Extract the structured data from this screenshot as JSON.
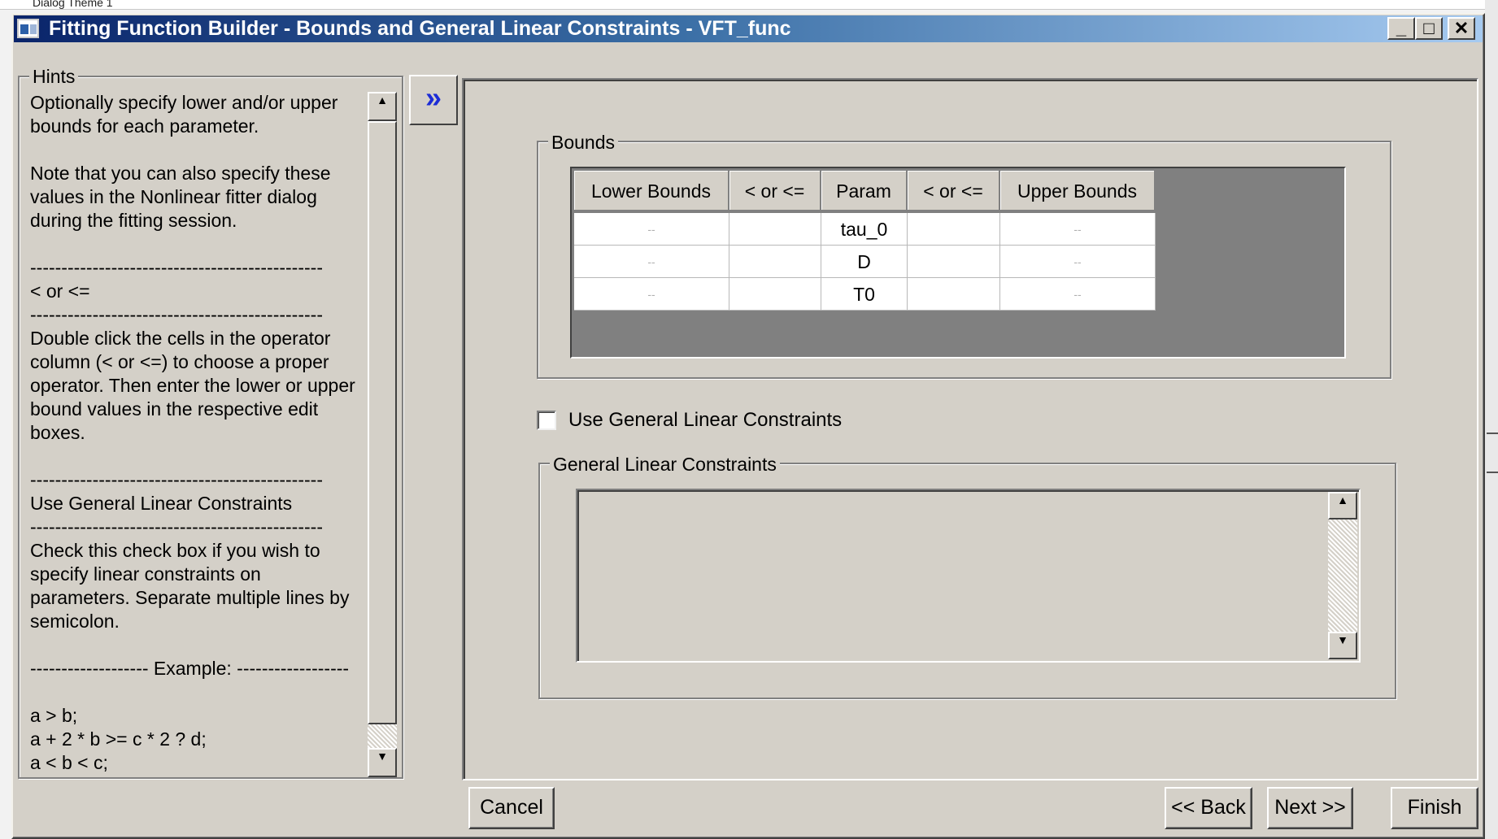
{
  "background": {
    "top_text": "Dialog Theme 1"
  },
  "window": {
    "title": "Fitting Function Builder - Bounds and General Linear Constraints - VFT_func",
    "controls": {
      "minimize": "_",
      "maximize": "□",
      "close": "✕"
    }
  },
  "hints": {
    "label": "Hints",
    "text": "Optionally specify lower and/or upper\nbounds for each parameter.\n\nNote that you can also specify these\nvalues in the Nonlinear fitter dialog\nduring the fitting session.\n\n-----------------------------------------------\n< or <=\n-----------------------------------------------\nDouble click the cells in the operator\ncolumn (< or <=) to choose a proper\noperator. Then enter the lower or upper\nbound values in the respective edit\nboxes.\n\n-----------------------------------------------\nUse General Linear Constraints\n-----------------------------------------------\nCheck this check box if you wish to\nspecify linear constraints on\nparameters. Separate multiple lines by\nsemicolon.\n\n------------------- Example: ------------------\n\na > b;\na + 2 * b >= c * 2 ? d;\na < b < c;"
  },
  "expand_button": "»",
  "bounds": {
    "label": "Bounds",
    "columns": [
      "Lower Bounds",
      "< or <=",
      "Param",
      "< or <=",
      "Upper Bounds"
    ],
    "rows": [
      {
        "lower": "--",
        "op1": "",
        "param": "tau_0",
        "op2": "",
        "upper": "--"
      },
      {
        "lower": "--",
        "op1": "",
        "param": "D",
        "op2": "",
        "upper": "--"
      },
      {
        "lower": "--",
        "op1": "",
        "param": "T0",
        "op2": "",
        "upper": "--"
      }
    ]
  },
  "use_constraints": {
    "label": "Use General Linear Constraints",
    "checked": false
  },
  "constraints": {
    "label": "General Linear Constraints",
    "value": ""
  },
  "buttons": {
    "cancel": "Cancel",
    "back": "<< Back",
    "next": "Next >>",
    "finish": "Finish"
  }
}
